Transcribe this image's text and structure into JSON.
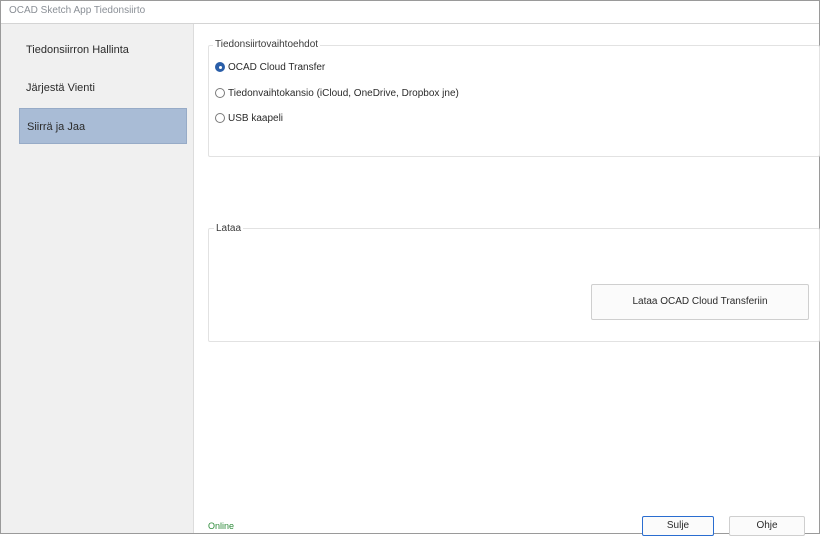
{
  "window": {
    "title": "OCAD Sketch App Tiedonsiirto"
  },
  "sidebar": {
    "items": [
      {
        "label": "Tiedonsiirron Hallinta",
        "active": false
      },
      {
        "label": "Järjestä Vienti",
        "active": false
      },
      {
        "label": "Siirrä ja Jaa",
        "active": true
      }
    ]
  },
  "transfer_options": {
    "title": "Tiedonsiirtovaihtoehdot",
    "options": [
      {
        "label": "OCAD Cloud Transfer",
        "checked": true
      },
      {
        "label": "Tiedonvaihtokansio (iCloud, OneDrive, Dropbox jne)",
        "checked": false
      },
      {
        "label": "USB kaapeli",
        "checked": false
      }
    ]
  },
  "upload": {
    "title": "Lataa",
    "button_label": "Lataa OCAD Cloud Transferiin"
  },
  "footer": {
    "status": "Online",
    "status_color": "#2e8b3a",
    "close_label": "Sulje",
    "help_label": "Ohje",
    "accent_color": "#2a6dd0"
  }
}
